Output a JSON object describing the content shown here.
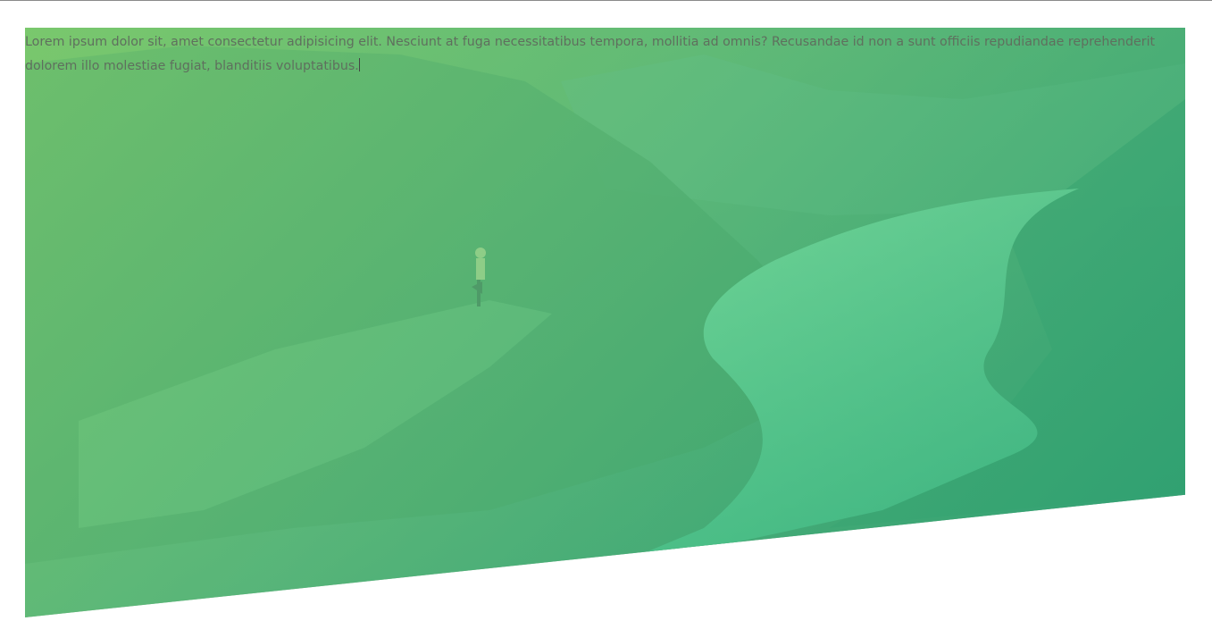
{
  "hero": {
    "paragraph": "Lorem ipsum dolor sit, amet consectetur adipisicing elit. Nesciunt at fuga necessitatibus tempora, mollitia ad omnis? Recusandae id non a sunt officiis repudiandae reprehenderit dolorem illo molestiae fugiat, blanditiis voluptatibus.",
    "background_image": "mountain-fjord-yoga-photo",
    "tint_colors": [
      "#7ed67a",
      "#60ce8c",
      "#2ca878"
    ]
  },
  "colors": {
    "text": "#5f6f5e",
    "page_background": "#ffffff",
    "top_rule": "#8a8a8a"
  }
}
